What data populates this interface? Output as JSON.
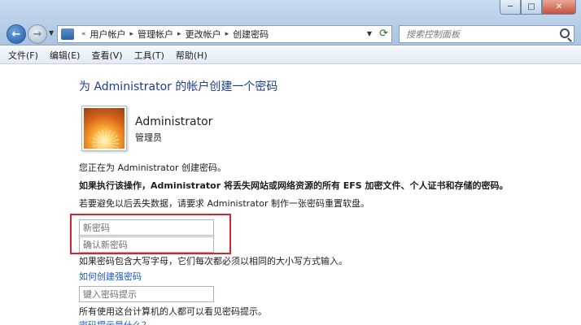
{
  "window": {
    "controls": {
      "minimize": "─",
      "maximize": "□",
      "close": "✕"
    }
  },
  "nav": {
    "back": "←",
    "forward": "→"
  },
  "address": {
    "crumbs": [
      "用户帐户",
      "管理帐户",
      "更改帐户",
      "创建密码"
    ]
  },
  "search": {
    "placeholder": "搜索控制面板"
  },
  "menu": {
    "items": [
      "文件(F)",
      "编辑(E)",
      "查看(V)",
      "工具(T)",
      "帮助(H)"
    ]
  },
  "page": {
    "title": "为 Administrator 的帐户创建一个密码",
    "user": {
      "name": "Administrator",
      "role": "管理员"
    },
    "lines": {
      "creating": "您正在为 Administrator 创建密码。",
      "warning": "如果执行该操作，Administrator 将丢失网站或网络资源的所有 EFS 加密文件、个人证书和存储的密码。",
      "advice": "若要避免以后丢失数据，请要求 Administrator 制作一张密码重置软盘。",
      "case_note": "如果密码包含大写字母，它们每次都必须以相同的大小写方式输入。",
      "hint_note": "所有使用这台计算机的人都可以看见密码提示。"
    },
    "inputs": {
      "new_password_placeholder": "新密码",
      "confirm_password_placeholder": "确认新密码",
      "hint_placeholder": "键入密码提示"
    },
    "links": {
      "strong_password": "如何创建强密码",
      "what_is_hint": "密码提示是什么？"
    }
  }
}
